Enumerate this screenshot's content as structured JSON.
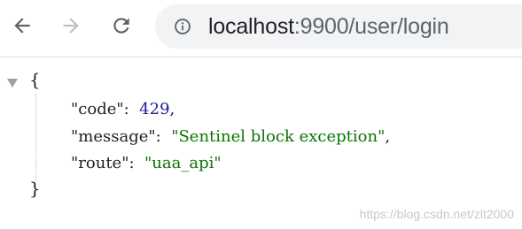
{
  "browser": {
    "back_icon": "arrow-left-icon",
    "forward_icon": "arrow-right-icon",
    "reload_icon": "reload-icon",
    "site_info_icon": "info-icon",
    "url": {
      "host": "localhost",
      "rest": ":9900/user/login"
    },
    "colors": {
      "toolbar_bg": "#ffffff",
      "omnibox_bg": "#f1f3f4",
      "icon_active": "#5f6368",
      "icon_disabled": "#bdc1c6"
    }
  },
  "json": {
    "open_brace": "{",
    "close_brace": "}",
    "entries": [
      {
        "key": "\"code\"",
        "value": "429",
        "type": "number",
        "trail": ","
      },
      {
        "key": "\"message\"",
        "value": "\"Sentinel block exception\"",
        "type": "string",
        "trail": ","
      },
      {
        "key": "\"route\"",
        "value": "\"uaa_api\"",
        "type": "string",
        "trail": ""
      }
    ],
    "colors": {
      "number": "#1a1aa6",
      "string": "#0b7500"
    }
  },
  "watermark": "https://blog.csdn.net/zlt2000"
}
